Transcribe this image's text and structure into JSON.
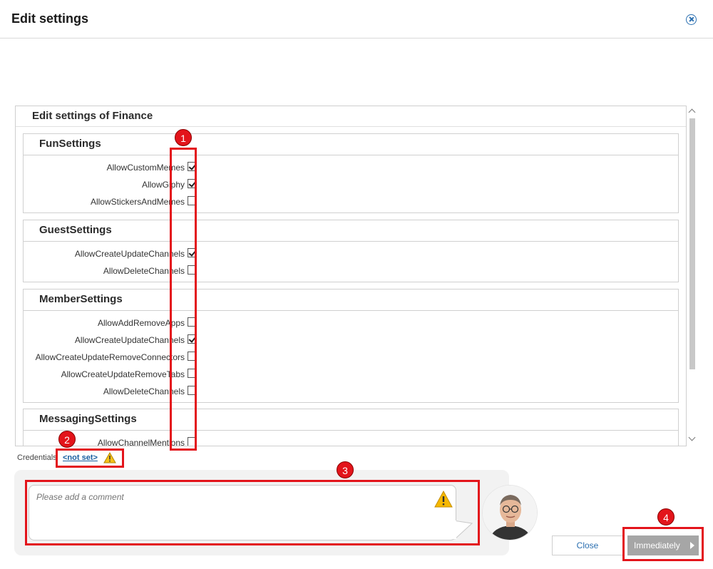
{
  "header": {
    "title": "Edit settings"
  },
  "panel": {
    "title": "Edit settings of Finance",
    "groups": [
      {
        "name": "FunSettings",
        "rows": [
          {
            "label": "AllowCustomMemes",
            "checked": true
          },
          {
            "label": "AllowGiphy",
            "checked": true
          },
          {
            "label": "AllowStickersAndMemes",
            "checked": false
          }
        ]
      },
      {
        "name": "GuestSettings",
        "rows": [
          {
            "label": "AllowCreateUpdateChannels",
            "checked": true
          },
          {
            "label": "AllowDeleteChannels",
            "checked": false
          }
        ]
      },
      {
        "name": "MemberSettings",
        "rows": [
          {
            "label": "AllowAddRemoveApps",
            "checked": false
          },
          {
            "label": "AllowCreateUpdateChannels",
            "checked": true
          },
          {
            "label": "AllowCreateUpdateRemoveConnectors",
            "checked": false
          },
          {
            "label": "AllowCreateUpdateRemoveTabs",
            "checked": false
          },
          {
            "label": "AllowDeleteChannels",
            "checked": false
          }
        ]
      },
      {
        "name": "MessagingSettings",
        "rows": [
          {
            "label": "AllowChannelMentions",
            "checked": false
          }
        ]
      }
    ]
  },
  "credentials": {
    "label": "Credentials",
    "value": "<not set>"
  },
  "comment": {
    "placeholder": "Please add a comment"
  },
  "buttons": {
    "close": "Close",
    "immediately": "Immediately"
  },
  "annotations": {
    "badges": [
      "1",
      "2",
      "3",
      "4"
    ],
    "color": "#e3141b"
  },
  "icons": {
    "close": "close-circle-icon",
    "warning": "warning-triangle-icon",
    "submit_arrow": "caret-right-icon"
  }
}
